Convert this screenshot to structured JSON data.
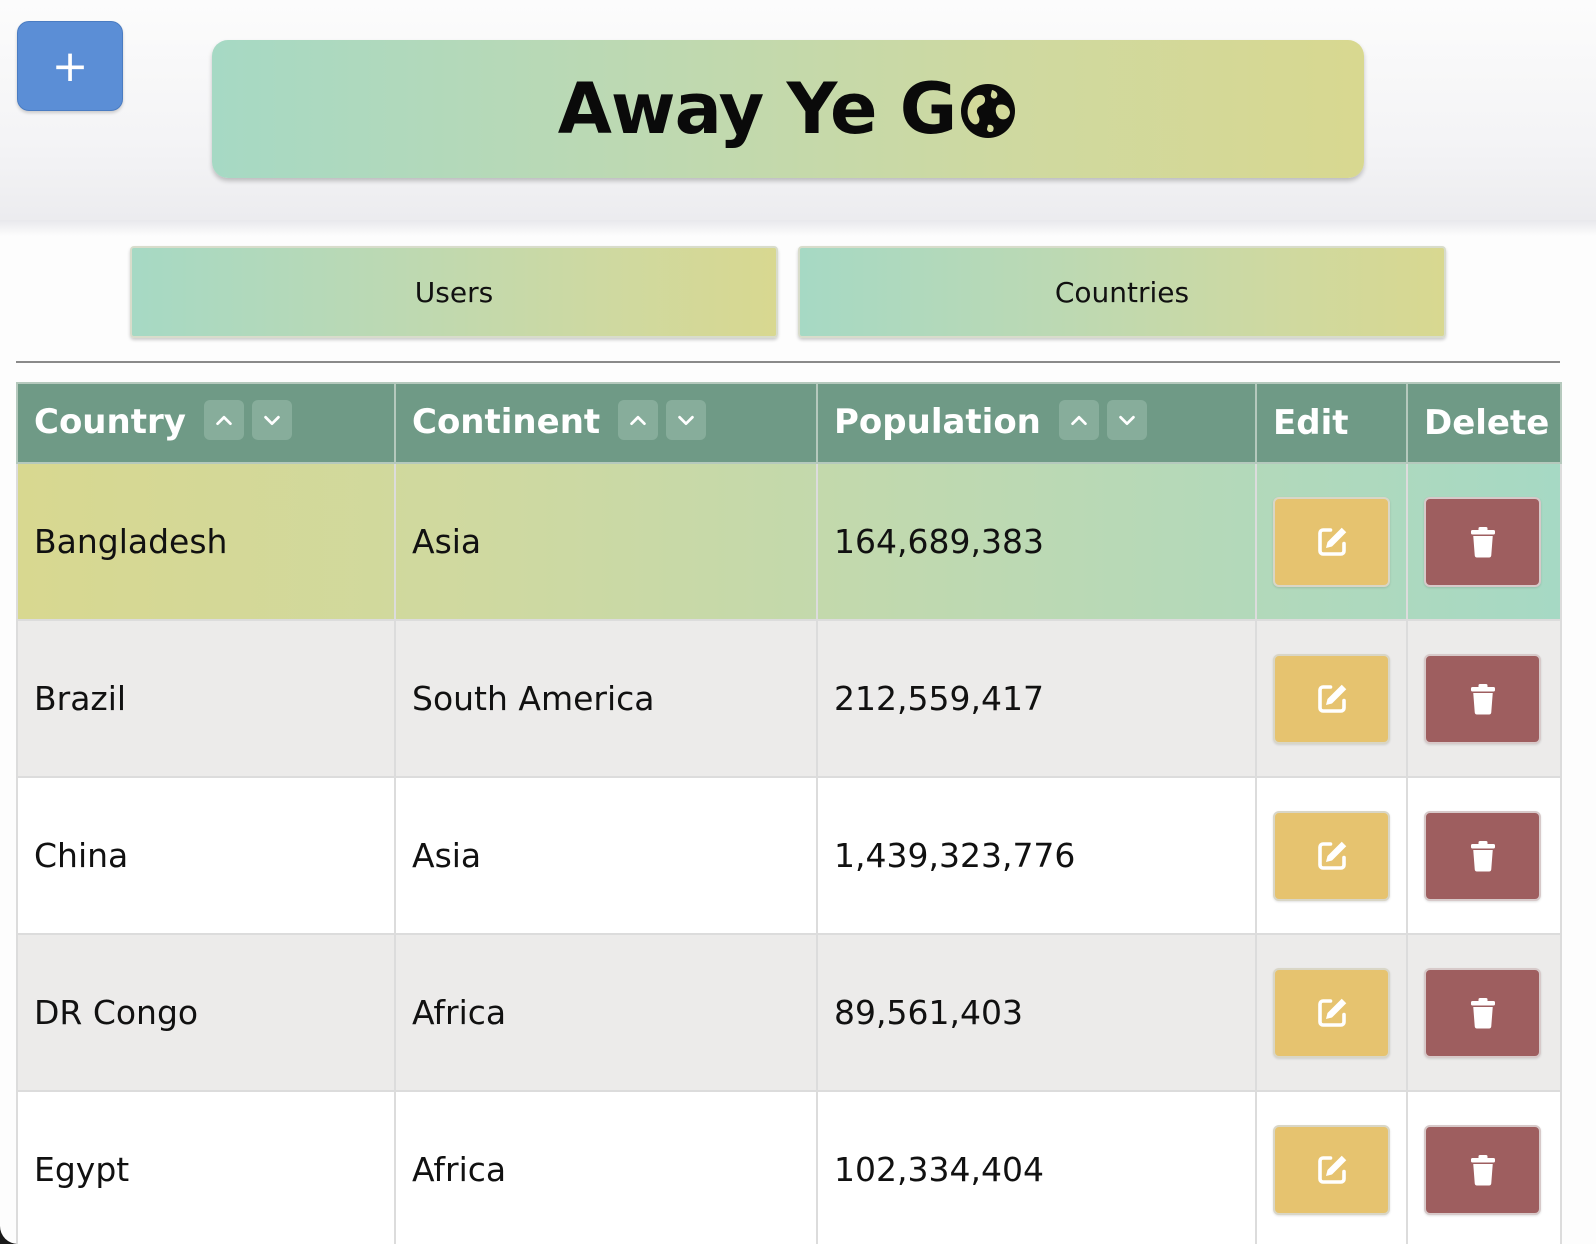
{
  "toolbar": {
    "add_label": "+"
  },
  "header": {
    "title": "Away Ye G",
    "title_icon": "globe-icon"
  },
  "nav": {
    "users_label": "Users",
    "countries_label": "Countries"
  },
  "table": {
    "columns": {
      "country": "Country",
      "continent": "Continent",
      "population": "Population",
      "edit": "Edit",
      "delete": "Delete"
    },
    "rows": [
      {
        "country": "Bangladesh",
        "continent": "Asia",
        "population": "164,689,383"
      },
      {
        "country": "Brazil",
        "continent": "South America",
        "population": "212,559,417"
      },
      {
        "country": "China",
        "continent": "Asia",
        "population": "1,439,323,776"
      },
      {
        "country": "DR Congo",
        "continent": "Africa",
        "population": "89,561,403"
      },
      {
        "country": "Egypt",
        "continent": "Africa",
        "population": "102,334,404"
      }
    ]
  },
  "colors": {
    "add_button": "#5b8ed6",
    "header_row": "#6f9a86",
    "edit_button": "#e6c36f",
    "delete_button": "#9e5e5f",
    "gradient_start": "#a6d9c4",
    "gradient_end": "#d8d890"
  }
}
